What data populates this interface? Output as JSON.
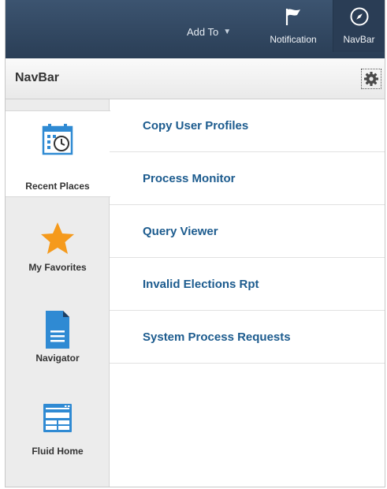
{
  "header": {
    "add_to_label": "Add To",
    "notification_label": "Notification",
    "navbar_label": "NavBar"
  },
  "panel": {
    "title": "NavBar"
  },
  "rail": {
    "items": [
      {
        "label": "Recent Places",
        "icon": "calendar-clock-icon",
        "active": true
      },
      {
        "label": "My Favorites",
        "icon": "star-icon",
        "active": false
      },
      {
        "label": "Navigator",
        "icon": "document-icon",
        "active": false
      },
      {
        "label": "Fluid Home",
        "icon": "home-grid-icon",
        "active": false
      }
    ]
  },
  "recent_places": [
    "Copy User Profiles",
    "Process Monitor",
    "Query Viewer",
    "Invalid Elections Rpt",
    "System Process Requests"
  ],
  "colors": {
    "header_bg": "#2f4560",
    "link": "#1c5b8e",
    "star": "#f59a1c",
    "icon_blue": "#2f8ad3"
  }
}
